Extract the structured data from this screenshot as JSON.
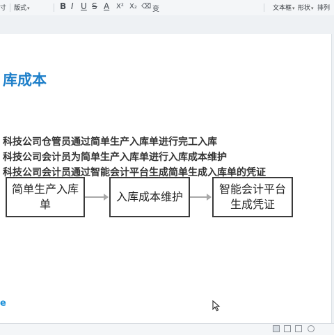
{
  "toolbar": {
    "left_fragment": "寸",
    "layout_label": "版式",
    "bold": "B",
    "italic": "I",
    "underline": "U",
    "strike": "S",
    "font_color": "A",
    "superscript": "X²",
    "subscript": "X₂",
    "clear_format": "⌫",
    "change_case": "变",
    "textbox_label": "文本框",
    "shape_label": "形状",
    "arrange_label": "排列"
  },
  "slide": {
    "title": "库成本",
    "bullets": [
      "科技公司仓管员通过简单生产入库单进行完工入库",
      "科技公司会计员为简单生产入库单进行入库成本维护",
      "科技公司会计员通过智能会计平台生成简单生成入库单的凭证"
    ],
    "flow": {
      "step1": "简单生产入库单",
      "step2": "入库成本维护",
      "step3": "智能会计平台生成凭证"
    },
    "logo_fragment": "e"
  }
}
